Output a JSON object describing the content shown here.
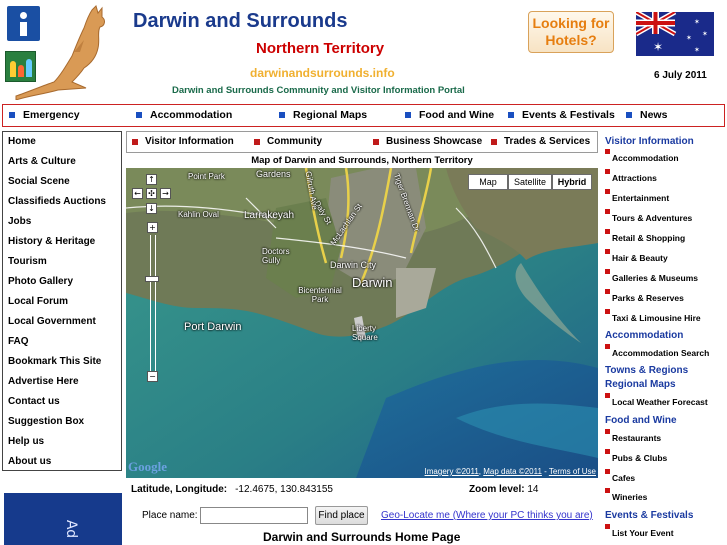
{
  "header": {
    "title": "Darwin and Surrounds",
    "subtitle": "Northern Territory",
    "url": "darwinandsurrounds.info",
    "tagline": "Darwin and Surrounds Community and Visitor Information Portal",
    "hotels_button": "Looking for Hotels?",
    "date": "6 July 2011",
    "icons": [
      "info-icon",
      "family-icon",
      "kangaroo-logo",
      "australian-flag"
    ]
  },
  "topnav": [
    "Emergency",
    "Accommodation",
    "Regional Maps",
    "Food and Wine",
    "Events & Festivals",
    "News"
  ],
  "leftmenu": [
    "Home",
    "Arts & Culture",
    "Social Scene",
    "Classifieds Auctions",
    "Jobs",
    "History & Heritage",
    "Tourism",
    "Photo Gallery",
    "Local Forum",
    "Local Government",
    "FAQ",
    "Bookmark This Site",
    "Advertise Here",
    "Contact us",
    "Suggestion Box",
    "Help us",
    "About us"
  ],
  "subnav": [
    "Visitor Information",
    "Community",
    "Business Showcase",
    "Trades & Services"
  ],
  "map": {
    "title": "Map of Darwin and Surrounds, Northern Territory",
    "types": [
      "Map",
      "Satellite",
      "Hybrid"
    ],
    "active_type": "Hybrid",
    "labels": {
      "gardens": "Gardens",
      "fort_park": "Point Park",
      "kahlin": "Kahlin Oval",
      "larrakeyah": "Larrakeyah",
      "doctors_gully": "Doctors Gully",
      "darwin_city": "Darwin City",
      "darwin": "Darwin",
      "bicentennial": "Bicentennial Park",
      "port_darwin": "Port Darwin",
      "liberty_square": "Liberty Square",
      "mclachlan": "McLachlan St",
      "stuart_hwy": "Tiger Brennan Dr",
      "daly": "Daly St",
      "gilruth": "Gilruth Ave"
    },
    "google_logo": "Google",
    "attribution_imagery": "Imagery ©2011",
    "attribution_mapdata": "Map data ©2011",
    "attribution_terms": "Terms of Use"
  },
  "coords": {
    "label": "Latitude, Longitude:",
    "value": "-12.4675, 130.843155",
    "zoom_label": "Zoom level:",
    "zoom_value": "14"
  },
  "search": {
    "label": "Place name:",
    "value": "",
    "button": "Find place",
    "geolocate": "Geo-Locate me (Where your PC thinks you are)"
  },
  "home_title": "Darwin and Surrounds Home Page",
  "right": {
    "visitor_info": "Visitor Information",
    "visitor_items": [
      "Accommodation",
      "Attractions",
      "Entertainment",
      "Tours & Adventures",
      "Retail & Shopping",
      "Hair & Beauty",
      "Galleries & Museums",
      "Parks & Reserves",
      "Taxi & Limousine Hire"
    ],
    "accommodation": "Accommodation",
    "accommodation_items": [
      "Accommodation Search"
    ],
    "towns": "Towns & Regions",
    "regional_maps": "Regional Maps",
    "regional_items": [
      "Local Weather Forecast"
    ],
    "food": "Food and Wine",
    "food_items": [
      "Restaurants",
      "Pubs & Clubs",
      "Cafes",
      "Wineries"
    ],
    "events": "Events & Festivals",
    "events_items": [
      "List Your Event"
    ]
  },
  "banner_text": "Ad"
}
